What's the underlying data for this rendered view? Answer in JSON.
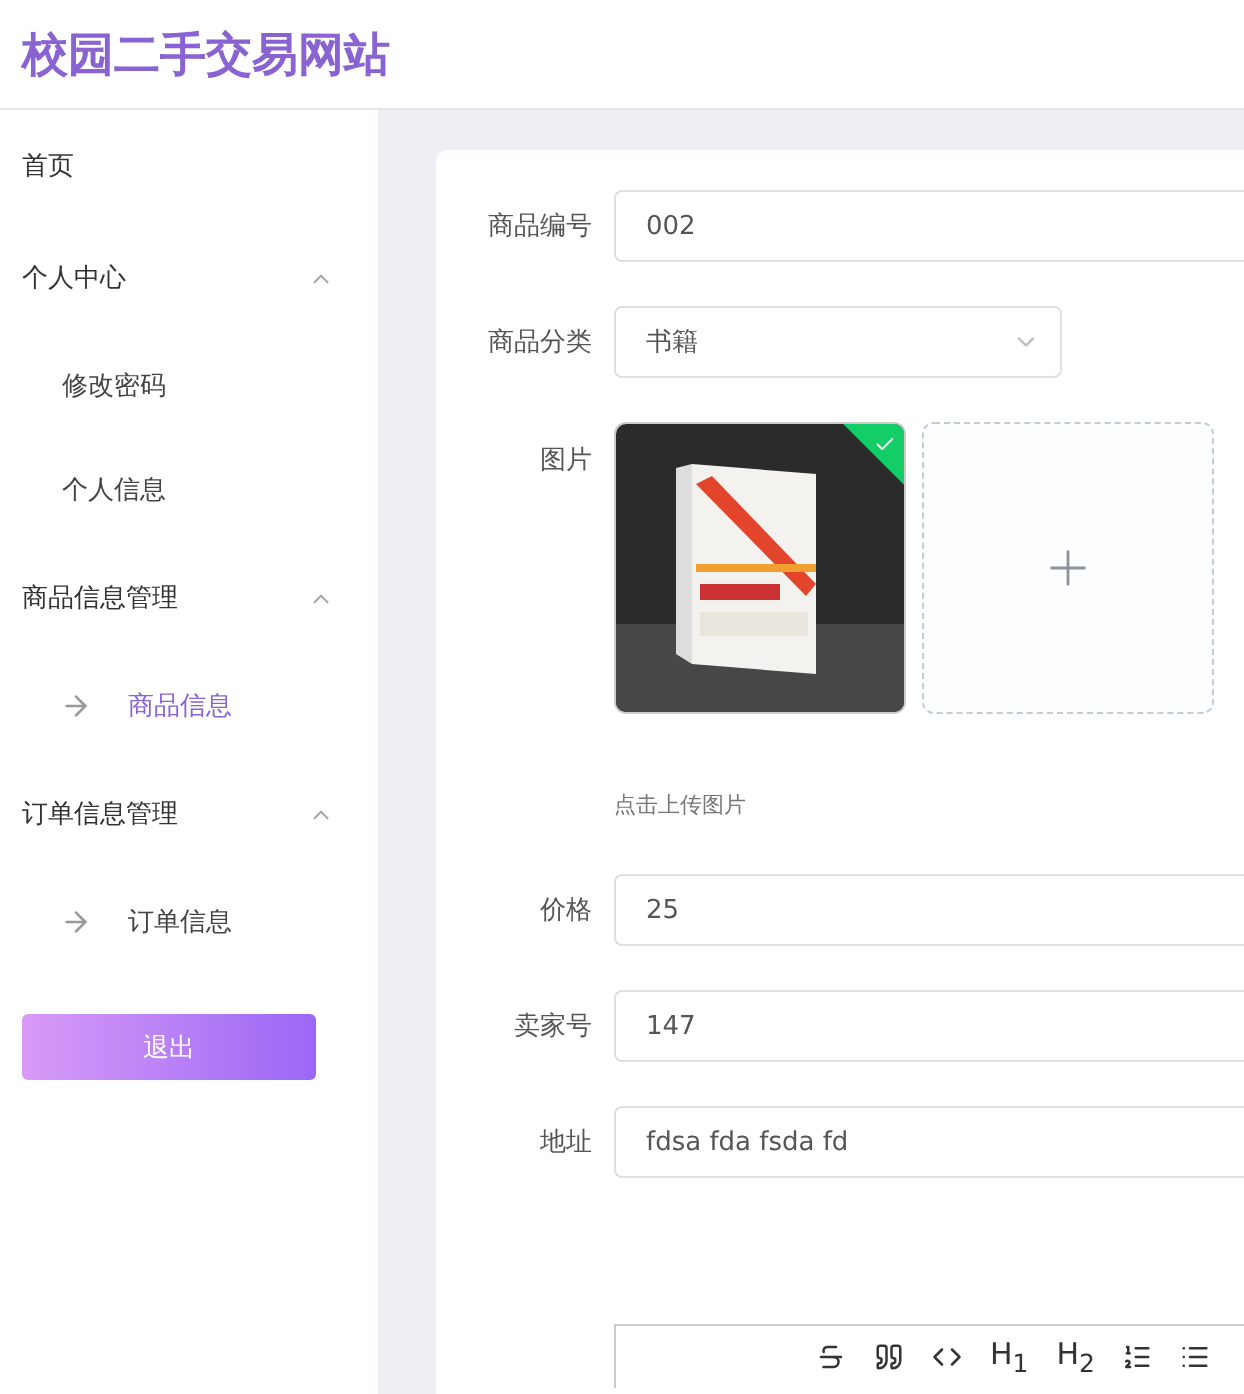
{
  "header": {
    "title": "校园二手交易网站"
  },
  "sidebar": {
    "items": [
      {
        "label": "首页"
      },
      {
        "label": "个人中心",
        "expanded": true,
        "children": [
          {
            "label": "修改密码",
            "selected": false
          },
          {
            "label": "个人信息",
            "selected": false
          }
        ]
      },
      {
        "label": "商品信息管理",
        "expanded": true,
        "children": [
          {
            "label": "商品信息",
            "selected": true
          }
        ]
      },
      {
        "label": "订单信息管理",
        "expanded": true,
        "children": [
          {
            "label": "订单信息",
            "selected": false
          }
        ]
      }
    ],
    "logout": "退出"
  },
  "form": {
    "fields": [
      {
        "kind": "input",
        "label": "商品编号",
        "value": "002"
      },
      {
        "kind": "select",
        "label": "商品分类",
        "value": "书籍"
      },
      {
        "label": "图片",
        "uploaded": true,
        "hint": "点击上传图片"
      },
      {
        "kind": "input",
        "label": "价格",
        "value": "25"
      },
      {
        "kind": "input",
        "label": "卖家号",
        "value": "147"
      },
      {
        "kind": "input",
        "label": "地址",
        "value": "fdsa fda fsda fd"
      }
    ],
    "editor_headings": [
      "H$_{1}$",
      "H$_{2}$"
    ]
  }
}
